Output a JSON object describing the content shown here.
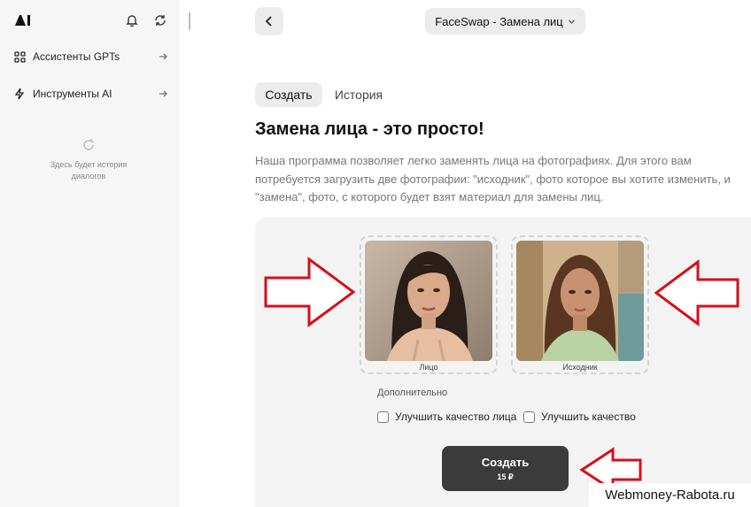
{
  "sidebar": {
    "items": [
      {
        "label": "Ассистенты GPTs",
        "icon": "grid-icon"
      },
      {
        "label": "Инструменты AI",
        "icon": "lightning-icon"
      }
    ],
    "history_empty": "Здесь будет история\nдиалогов"
  },
  "header": {
    "tool_name": "FaceSwap - Замена лиц"
  },
  "tabs": [
    {
      "label": "Создать",
      "active": true
    },
    {
      "label": "История",
      "active": false
    }
  ],
  "main": {
    "title": "Замена лица - это просто!",
    "description": "Наша программа позволяет легко заменять лица на фотографиях. Для этого вам потребуется загрузить две фотографии: \"исходник\", фото которое вы хотите изменить, и \"замена\", фото, с которого будет взят материал для замены лиц."
  },
  "upload": {
    "face_label": "Лицо",
    "source_label": "Исходник"
  },
  "options": {
    "title": "Дополнительно",
    "checkboxes": [
      {
        "label": "Улучшить качество лица",
        "checked": false
      },
      {
        "label": "Улучшить качество",
        "checked": false
      }
    ]
  },
  "create_button": {
    "label": "Создать",
    "price": "15 ₽"
  },
  "watermark": "Webmoney-Rabota.ru",
  "colors": {
    "sidebar_bg": "#f6f6f6",
    "panel_bg": "#f3f3f3",
    "button_dark": "#3b3b3b",
    "annotation_red": "#d4101a"
  }
}
